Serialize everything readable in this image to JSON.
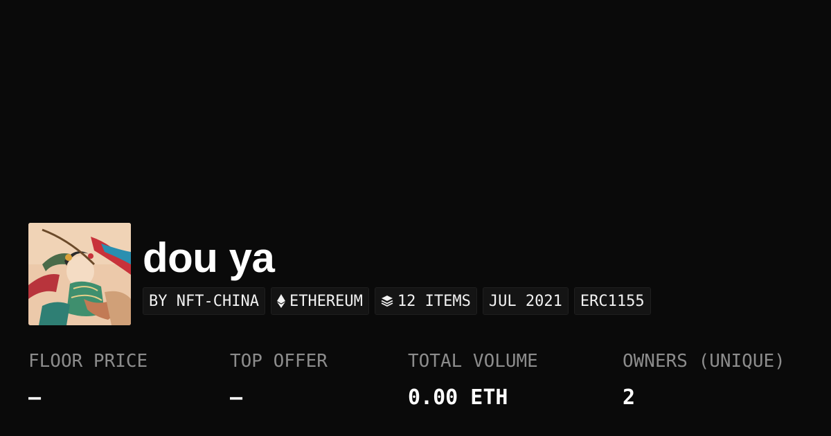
{
  "collection": {
    "name": "dou ya",
    "avatar_alt": "collection avatar"
  },
  "chips": {
    "creator": "BY NFT-CHINA",
    "chain": "ETHEREUM",
    "items": "12 ITEMS",
    "date": "JUL 2021",
    "standard": "ERC1155",
    "chain_icon": "ethereum-icon",
    "items_icon": "layers-icon"
  },
  "stats": {
    "floor_price": {
      "label": "FLOOR PRICE",
      "value": "–"
    },
    "top_offer": {
      "label": "TOP OFFER",
      "value": "–"
    },
    "total_volume": {
      "label": "TOTAL VOLUME",
      "value": "0.00 ETH"
    },
    "owners": {
      "label": "OWNERS (UNIQUE)",
      "value": "2"
    }
  },
  "colors": {
    "background": "#0a0a0a",
    "chip_background": "#141414",
    "label_gray": "#8c8c8c",
    "text": "#ffffff"
  }
}
